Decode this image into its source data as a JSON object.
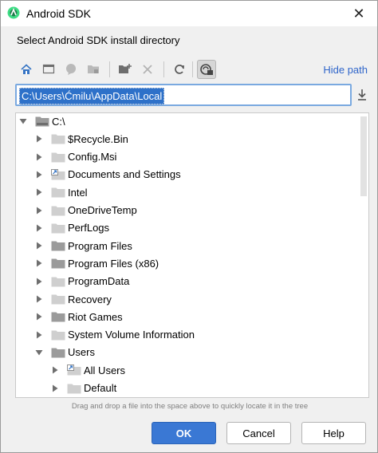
{
  "window": {
    "title": "Android SDK",
    "close_glyph": "✕"
  },
  "subtitle": "Select Android SDK install directory",
  "toolbar": {
    "buttons": [
      {
        "icon": "home-icon"
      },
      {
        "icon": "desktop-icon"
      },
      {
        "icon": "project-icon"
      },
      {
        "icon": "module-folder-icon"
      },
      {
        "icon": "new-folder-icon"
      },
      {
        "icon": "delete-icon"
      },
      {
        "icon": "refresh-icon"
      },
      {
        "icon": "show-hidden-icon",
        "active": true
      }
    ],
    "hide_path_label": "Hide path"
  },
  "path": {
    "value": "C:\\Users\\Ćmilu\\AppData\\Local"
  },
  "tree": {
    "items": [
      {
        "label": "C:\\",
        "expanded": true,
        "depth": 0,
        "icon": "drive-icon"
      },
      {
        "label": "$Recycle.Bin",
        "expanded": false,
        "depth": 1,
        "icon": "folder-light"
      },
      {
        "label": "Config.Msi",
        "expanded": false,
        "depth": 1,
        "icon": "folder-light"
      },
      {
        "label": "Documents and Settings",
        "expanded": false,
        "depth": 1,
        "icon": "folder-link"
      },
      {
        "label": "Intel",
        "expanded": false,
        "depth": 1,
        "icon": "folder-light"
      },
      {
        "label": "OneDriveTemp",
        "expanded": false,
        "depth": 1,
        "icon": "folder-light"
      },
      {
        "label": "PerfLogs",
        "expanded": false,
        "depth": 1,
        "icon": "folder-light"
      },
      {
        "label": "Program Files",
        "expanded": false,
        "depth": 1,
        "icon": "folder-dark"
      },
      {
        "label": "Program Files (x86)",
        "expanded": false,
        "depth": 1,
        "icon": "folder-dark"
      },
      {
        "label": "ProgramData",
        "expanded": false,
        "depth": 1,
        "icon": "folder-light"
      },
      {
        "label": "Recovery",
        "expanded": false,
        "depth": 1,
        "icon": "folder-light"
      },
      {
        "label": "Riot Games",
        "expanded": false,
        "depth": 1,
        "icon": "folder-dark"
      },
      {
        "label": "System Volume Information",
        "expanded": false,
        "depth": 1,
        "icon": "folder-light"
      },
      {
        "label": "Users",
        "expanded": true,
        "depth": 1,
        "icon": "folder-dark"
      },
      {
        "label": "All Users",
        "expanded": false,
        "depth": 2,
        "icon": "folder-link"
      },
      {
        "label": "Default",
        "expanded": false,
        "depth": 2,
        "icon": "folder-light"
      }
    ]
  },
  "hint": "Drag and drop a file into the space above to quickly locate it in the tree",
  "buttons": {
    "ok": "OK",
    "cancel": "Cancel",
    "help": "Help"
  },
  "colors": {
    "accent": "#3a78d4",
    "link": "#2f65ca",
    "selection": "#2e71c9"
  }
}
